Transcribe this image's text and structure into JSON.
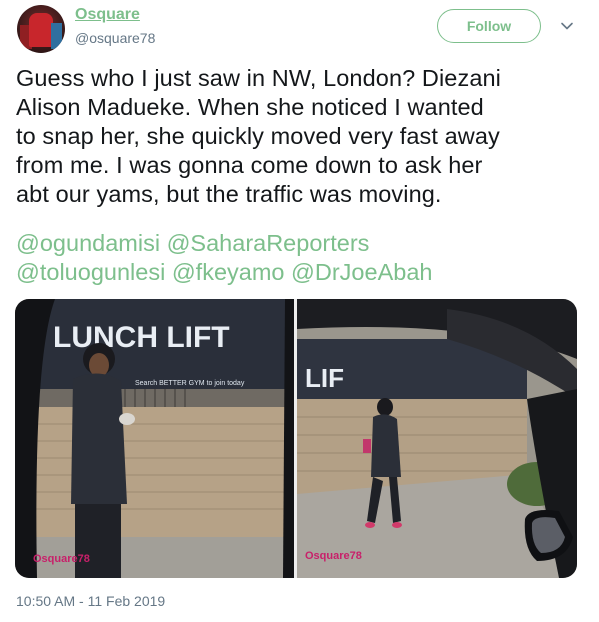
{
  "author": {
    "name": "Osquare",
    "handle": "@osquare78"
  },
  "follow_label": "Follow",
  "tweet": {
    "text": "Guess who I just saw in NW, London? Diezani\nAlison Madueke. When she noticed I wanted\nto snap her, she quickly moved very fast away\nfrom me. I was gonna come down to ask her\nabt our yams, but the traffic was moving.",
    "mentions": [
      "@ogundamisi",
      "@SaharaReporters",
      "@toluogunlesi",
      "@fkeyamo",
      "@DrJoeAbah"
    ]
  },
  "photos": [
    {
      "watermark": "Osquare78",
      "sign_text": "LUNCH LIFT",
      "sign_subtext": "Search BETTER GYM to join today"
    },
    {
      "watermark": "Osquare78",
      "sign_text": "LIF"
    }
  ],
  "timestamp": "10:50 AM - 11 Feb 2019",
  "colors": {
    "accent": "#7dbf8c",
    "secondary_text": "#657786",
    "watermark": "#c8206a"
  },
  "icons": {
    "caret": "chevron-down-icon"
  }
}
